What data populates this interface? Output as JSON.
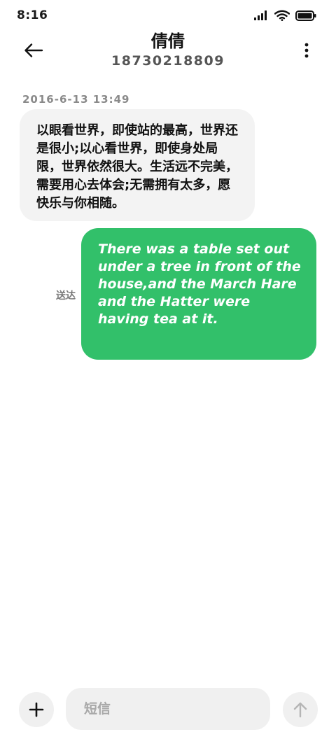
{
  "status_bar": {
    "time": "8:16",
    "icons": [
      "signal-icon",
      "wifi-icon",
      "battery-icon"
    ]
  },
  "header": {
    "contact_name": "倩倩",
    "contact_number": "18730218809",
    "back_icon": "arrow-left-icon",
    "more_icon": "more-vertical-icon"
  },
  "conversation": {
    "timestamp": "2016-6-13 13:49",
    "incoming_message": "以眼看世界，即使站的最高，世界还是很小;以心看世界，即使身处局限，世界依然很大。生活远不完美，需要用心去体会;无需拥有太多，愿快乐与你相随。",
    "outgoing_message": "There was a table set out under a tree in front of the house,and the March Hare and the Hatter were having tea at it.",
    "outgoing_status": "送达"
  },
  "composer": {
    "placeholder": "短信",
    "add_icon": "plus-icon",
    "send_icon": "arrow-up-icon"
  },
  "colors": {
    "outgoing_bubble": "#32c06a",
    "incoming_bubble": "#f3f3f3",
    "composer_bg": "#f0f0f0"
  }
}
